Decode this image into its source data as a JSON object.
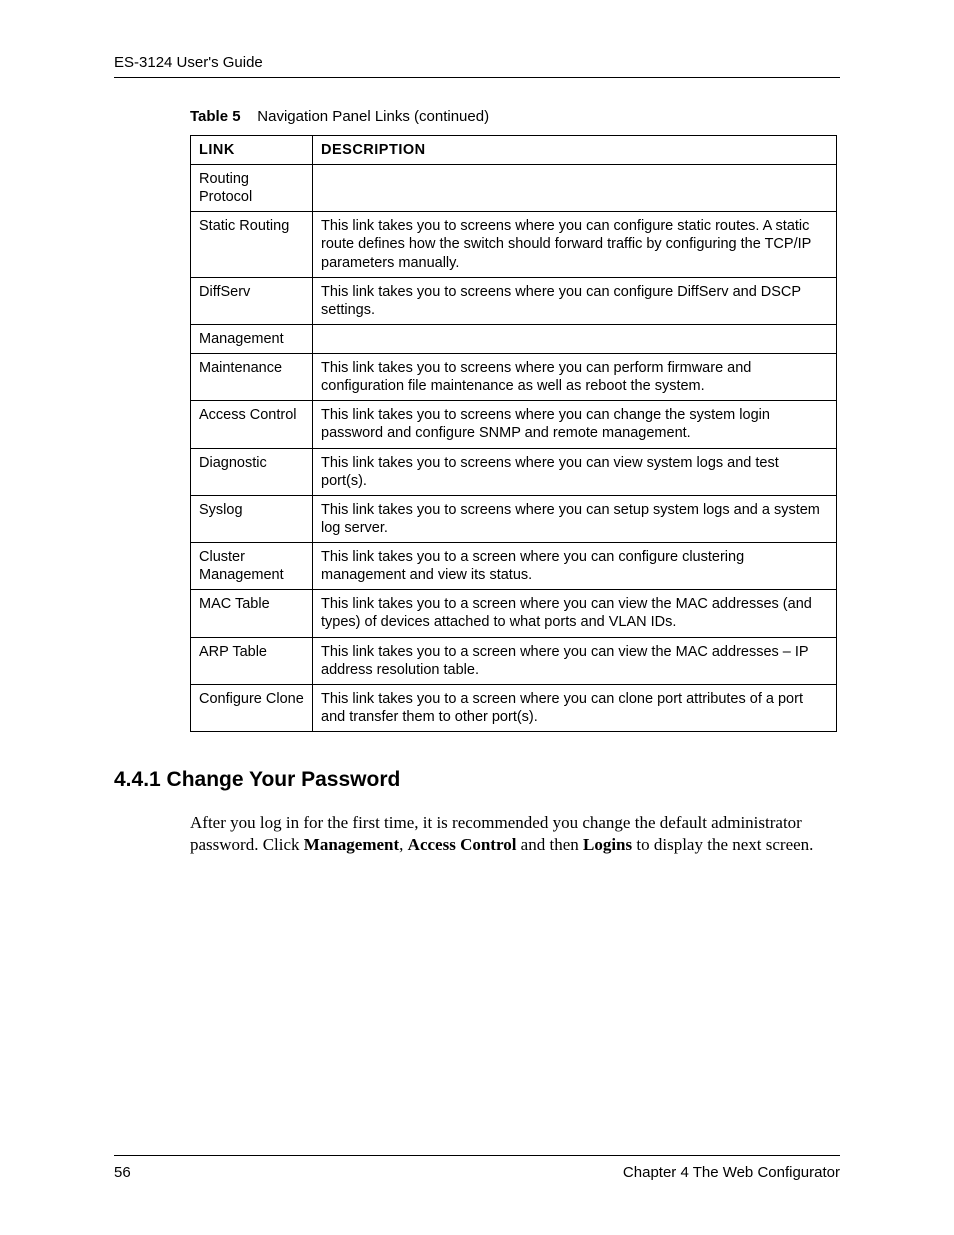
{
  "header": {
    "guide_title": "ES-3124 User's Guide"
  },
  "table": {
    "caption_prefix": "Table 5",
    "caption_text": "Navigation Panel Links  (continued)",
    "columns": {
      "link": "LINK",
      "description": "DESCRIPTION"
    },
    "rows": [
      {
        "link": "Routing Protocol",
        "desc": ""
      },
      {
        "link": "Static Routing",
        "desc": "This link takes you to screens where you can configure static routes. A static route defines how the switch should forward traffic by configuring the TCP/IP parameters manually."
      },
      {
        "link": "DiffServ",
        "desc": "This link takes you to screens where you can configure DiffServ and DSCP settings."
      },
      {
        "link": "Management",
        "desc": ""
      },
      {
        "link": "Maintenance",
        "desc": "This link takes you to screens where you can perform firmware and configuration file maintenance as well as reboot the system."
      },
      {
        "link": "Access Control",
        "desc": "This link takes you to screens where you can change the system login password and configure SNMP and remote management."
      },
      {
        "link": "Diagnostic",
        "desc": "This link takes you to screens where you can view system logs and test port(s)."
      },
      {
        "link": "Syslog",
        "desc": "This link takes you to screens where you can setup system logs and a system log server."
      },
      {
        "link": "Cluster Management",
        "desc": "This link takes you to a screen where you can configure clustering management and view its status."
      },
      {
        "link": "MAC Table",
        "desc": "This link takes you to a screen where you can view the MAC addresses (and types) of devices attached to what ports and VLAN IDs."
      },
      {
        "link": "ARP Table",
        "desc": "This link takes you to a screen where you can view the MAC addresses – IP address resolution table."
      },
      {
        "link": "Configure Clone",
        "desc": "This link takes you to a screen where you can clone port attributes of a port and transfer them to other port(s)."
      }
    ]
  },
  "section": {
    "heading": "4.4.1  Change Your Password",
    "para_parts": {
      "p1": "After you log in for the first time, it is recommended you change the default administrator password. Click ",
      "b1": "Management",
      "p2": ", ",
      "b2": "Access Control",
      "p3": " and then ",
      "b3": "Logins",
      "p4": " to display the next screen."
    }
  },
  "footer": {
    "page_number": "56",
    "chapter": "Chapter 4 The Web Configurator"
  }
}
